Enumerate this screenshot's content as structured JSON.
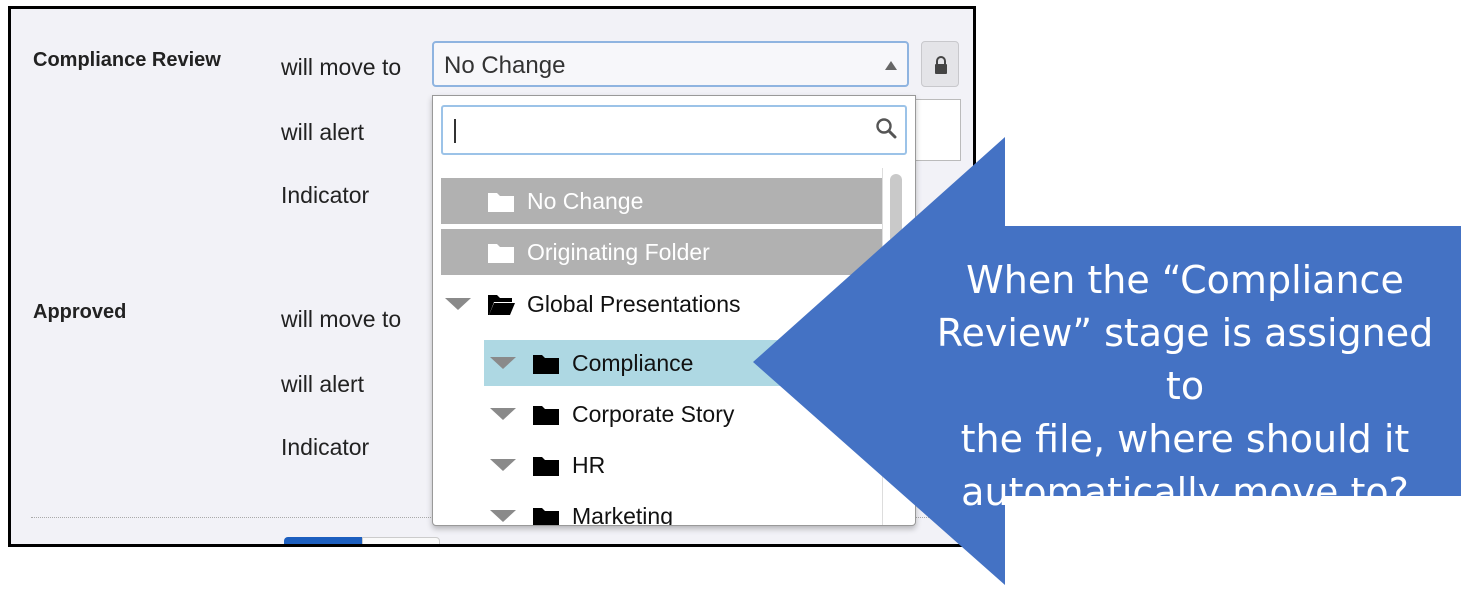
{
  "stages": [
    {
      "name": "Compliance Review",
      "rows": {
        "move": "will move to",
        "alert": "will alert",
        "indicator": "Indicator"
      }
    },
    {
      "name": "Approved",
      "rows": {
        "move": "will move to",
        "alert": "will alert",
        "indicator": "Indicator"
      }
    }
  ],
  "move_select": {
    "value": "No Change",
    "expanded": true
  },
  "dropdown": {
    "search_value": "",
    "items": [
      {
        "label": "No Change",
        "state": "disabled"
      },
      {
        "label": "Originating Folder",
        "state": "disabled"
      },
      {
        "label": "Global Presentations",
        "expanded": true
      },
      {
        "label": "Compliance",
        "selected": true
      },
      {
        "label": "Corporate Story"
      },
      {
        "label": "HR"
      },
      {
        "label": "Marketing"
      }
    ]
  },
  "icons": {
    "lock": "lock-icon",
    "search": "search-icon",
    "folder": "folder-icon",
    "folder_open": "folder-open-icon",
    "expand": "triangle-down-icon"
  },
  "callout": {
    "lines": [
      "When the “Compliance",
      "Review” stage is assigned to",
      "the file, where should it",
      "automatically move to?"
    ],
    "color": "#4472c4"
  },
  "colors": {
    "selected_row": "#aed8e3",
    "disabled_row": "#b1b1b1",
    "primary_button": "#1d5fbf"
  }
}
